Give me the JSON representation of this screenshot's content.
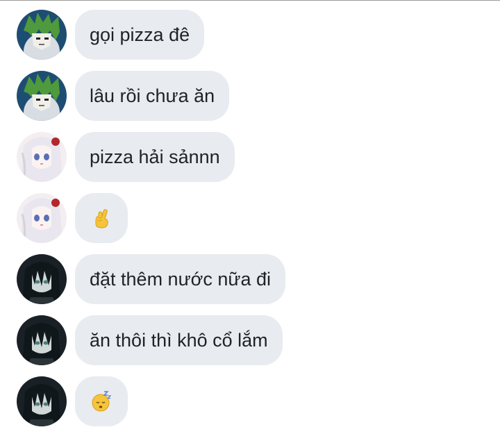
{
  "conversation": {
    "messages": [
      {
        "sender": "green-hair",
        "text": "gọi pizza đê",
        "emoji": null
      },
      {
        "sender": "green-hair",
        "text": "lâu rồi chưa ăn",
        "emoji": null
      },
      {
        "sender": "white-hair",
        "text": "pizza hải sảnnn",
        "emoji": null
      },
      {
        "sender": "white-hair",
        "text": "",
        "emoji": "crossed-fingers-hand"
      },
      {
        "sender": "dark-hair",
        "text": "đặt thêm nước nữa đi",
        "emoji": null
      },
      {
        "sender": "dark-hair",
        "text": "ăn thôi thì khô cổ lắm",
        "emoji": null
      },
      {
        "sender": "dark-hair",
        "text": "",
        "emoji": "sleeping-face"
      }
    ]
  },
  "colors": {
    "bubble_bg": "#e8ebef",
    "text": "#1f2326",
    "emoji_yellow": "#f6c43a"
  }
}
